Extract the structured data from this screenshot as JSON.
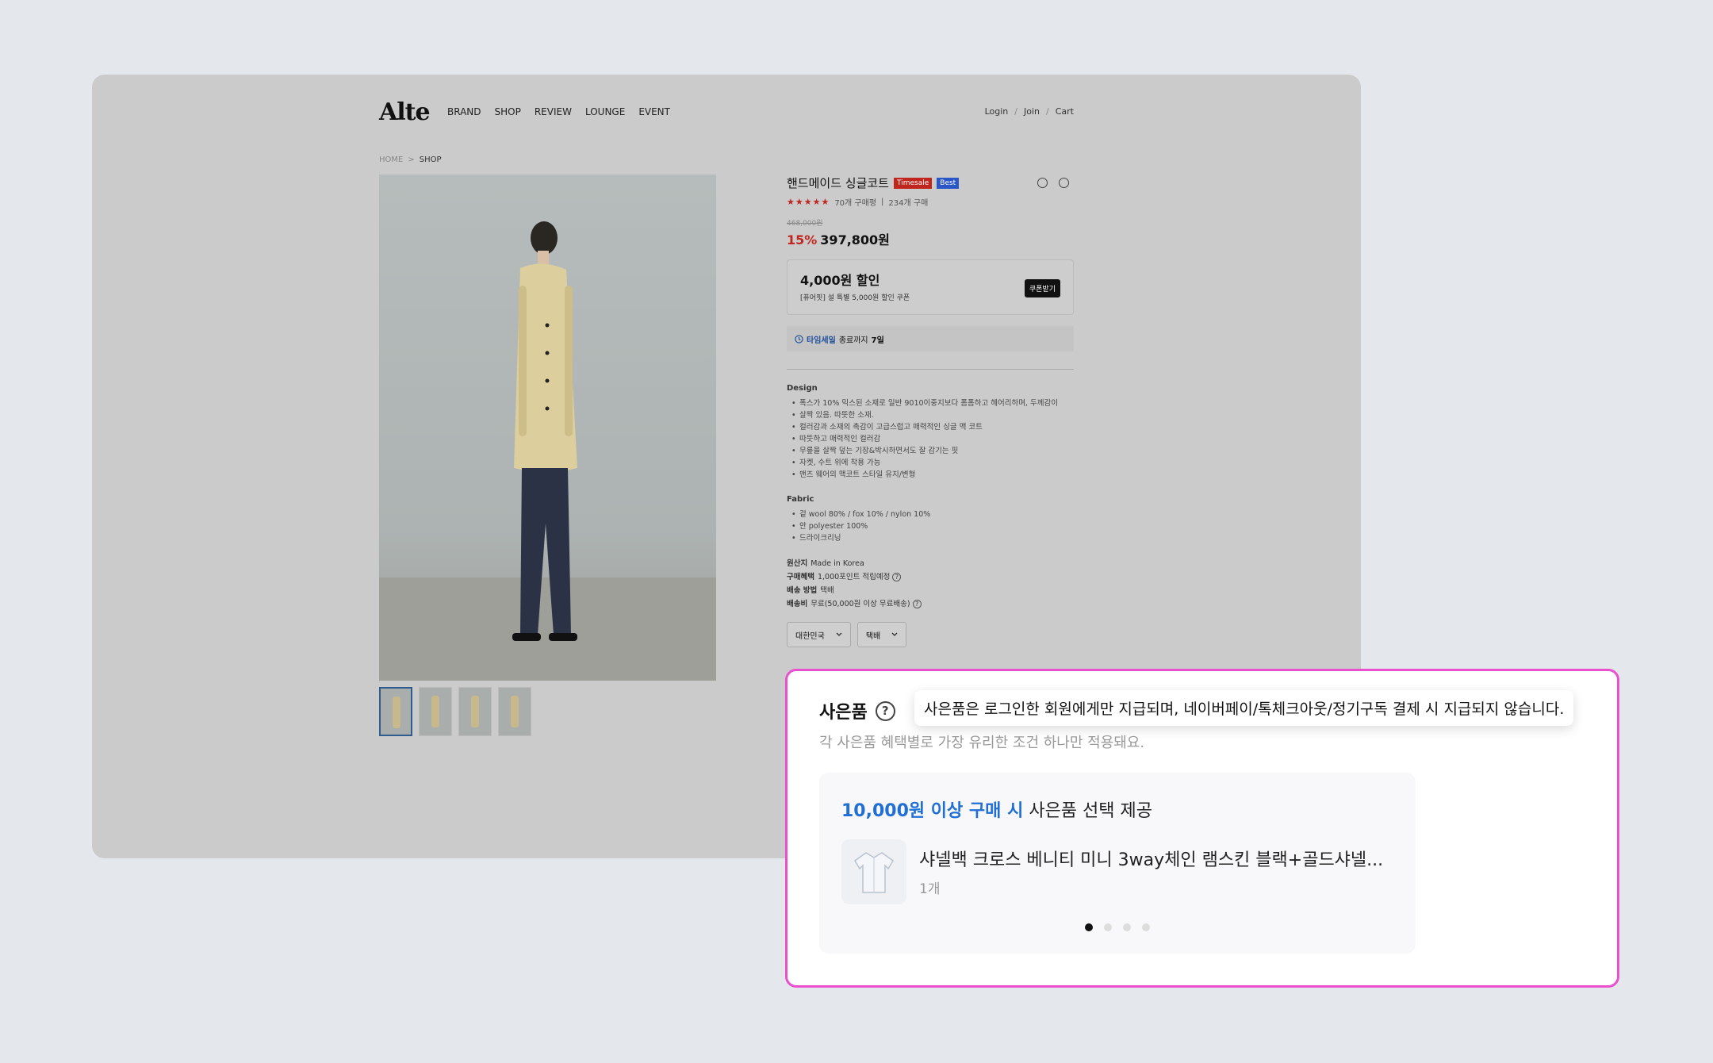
{
  "header": {
    "logo": "Alte",
    "nav": [
      "BRAND",
      "SHOP",
      "REVIEW",
      "LOUNGE",
      "EVENT"
    ],
    "links": [
      "Login",
      "Join",
      "Cart"
    ],
    "link_sep": "/"
  },
  "breadcrumb": {
    "home": "HOME",
    "sep": ">",
    "current": "SHOP"
  },
  "product": {
    "title": "핸드메이드 싱글코트",
    "badges": [
      "Timesale",
      "Best"
    ],
    "stars": "★★★★★",
    "rating_text_1": "70개 구매평",
    "rating_sep": "|",
    "rating_text_2": "234개 구매",
    "original_price": "468,000원",
    "discount": "15%",
    "price": "397,800원"
  },
  "coupon": {
    "title": "4,000원 할인",
    "subtitle": "[퓨어핏] 설 특별 5,000원 할인 쿠폰",
    "button": "쿠폰받기"
  },
  "timesale": {
    "label": "타임세일",
    "text": "종료까지",
    "days": "7일"
  },
  "design": {
    "heading": "Design",
    "items": [
      "폭스가 10% 믹스된 소재로 일반 9010이중지보다 폼폼하고 헤어리하며, 두께감이",
      "살짝 있음. 따뜻한 소재.",
      "컬러감과 소재의 촉감이 고급스럽고 매력적인 싱글 맥 코트",
      "따뜻하고 매력적인 컬러감",
      "무릎을 살짝 덮는 기장&박시하면서도 잘 감기는 핏",
      "자켓, 수트 위에 착용 가능",
      "맨즈 웨어의 맥코트 스타일 유지/변형"
    ]
  },
  "fabric": {
    "heading": "Fabric",
    "items": [
      "겉 wool 80% / fox 10% / nylon 10%",
      "안 polyester 100%",
      "드라이크리닝"
    ]
  },
  "meta": {
    "origin_label": "원산지",
    "origin_value": "Made in Korea",
    "benefit_label": "구매혜택",
    "benefit_value": "1,000포인트 적립예정",
    "ship_label": "배송 방법",
    "ship_value": "택배",
    "fee_label": "배송비",
    "fee_value": "무료(50,000원 이상 무료배송)",
    "help_glyph": "?"
  },
  "selects": {
    "country": "대한민국",
    "shipping": "택배"
  },
  "gift": {
    "title": "사은품",
    "help_glyph": "?",
    "tooltip": "사은품은 로그인한 회원에게만 지급되며, 네이버페이/톡체크아웃/정기구독 결제 시 지급되지 않습니다.",
    "subtitle": "각 사은품 혜택별로 가장 유리한 조건 하나만 적용돼요.",
    "condition_highlight": "10,000원 이상 구매 시",
    "condition_rest": "사은품 선택 제공",
    "product_name": "샤넬백 크로스 베니티 미니 3way체인 램스킨 블랙+골드샤넬...",
    "quantity": "1개",
    "dots_total": 4,
    "dots_active": 0
  },
  "colors": {
    "accent_blue": "#1f6fd6",
    "highlight_border": "#ea4fcf",
    "sale_red": "#c0261d"
  }
}
